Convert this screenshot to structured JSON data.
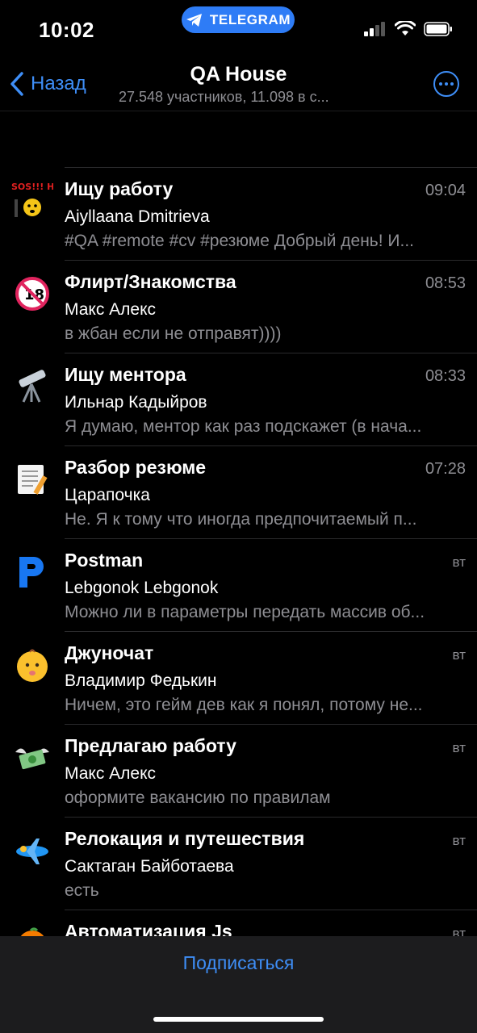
{
  "status_bar": {
    "time": "10:02",
    "app_pill_label": "TELEGRAM"
  },
  "nav": {
    "back_label": "Назад",
    "title": "QA House",
    "subtitle": "27.548 участников, 11.098 в с..."
  },
  "topics": [
    {
      "icon": "sos-emoji-icon",
      "title": "Ищу работу",
      "time": "09:04",
      "sender": "Aiyllaana Dmitrieva",
      "preview": "#QA #remote #cv #резюме Добрый день! И..."
    },
    {
      "icon": "no-under-18-icon",
      "title": "Флирт/Знакомства",
      "time": "08:53",
      "sender": "Макс Алекс",
      "preview": "в жбан если не отправят))))"
    },
    {
      "icon": "telescope-icon",
      "title": "Ищу ментора",
      "time": "08:33",
      "sender": "Ильнар Кадыйров",
      "preview": "Я думаю, ментор как раз подскажет (в нача..."
    },
    {
      "icon": "memo-icon",
      "title": "Разбор резюме",
      "time": "07:28",
      "sender": "Царапочка",
      "preview": "Не. Я к тому что иногда предпочитаемый п..."
    },
    {
      "icon": "postman-p-icon",
      "title": "Postman",
      "time": "вт",
      "sender": "Lebgonok Lebgonok",
      "preview": "Можно ли в параметры передать массив об..."
    },
    {
      "icon": "baby-icon",
      "title": "Джуночат",
      "time": "вт",
      "sender": "Владимир Федькин",
      "preview": "Ничем, это гейм дев как я понял, потому не..."
    },
    {
      "icon": "money-wings-icon",
      "title": "Предлагаю работу",
      "time": "вт",
      "sender": "Макс Алекс",
      "preview": "оформите вакансию по правилам"
    },
    {
      "icon": "airplane-icon",
      "title": "Релокация и путешествия",
      "time": "вт",
      "sender": "Сактаган Байботаева",
      "preview": "есть"
    },
    {
      "icon": "orange-icon",
      "title": "Автоматизация Js",
      "time": "вт",
      "sender": "",
      "preview": ""
    }
  ],
  "bottom_bar": {
    "subscribe_label": "Подписаться"
  },
  "colors": {
    "accent": "#3e8ef7",
    "background": "#000000",
    "secondary_text": "#8e8e93"
  }
}
